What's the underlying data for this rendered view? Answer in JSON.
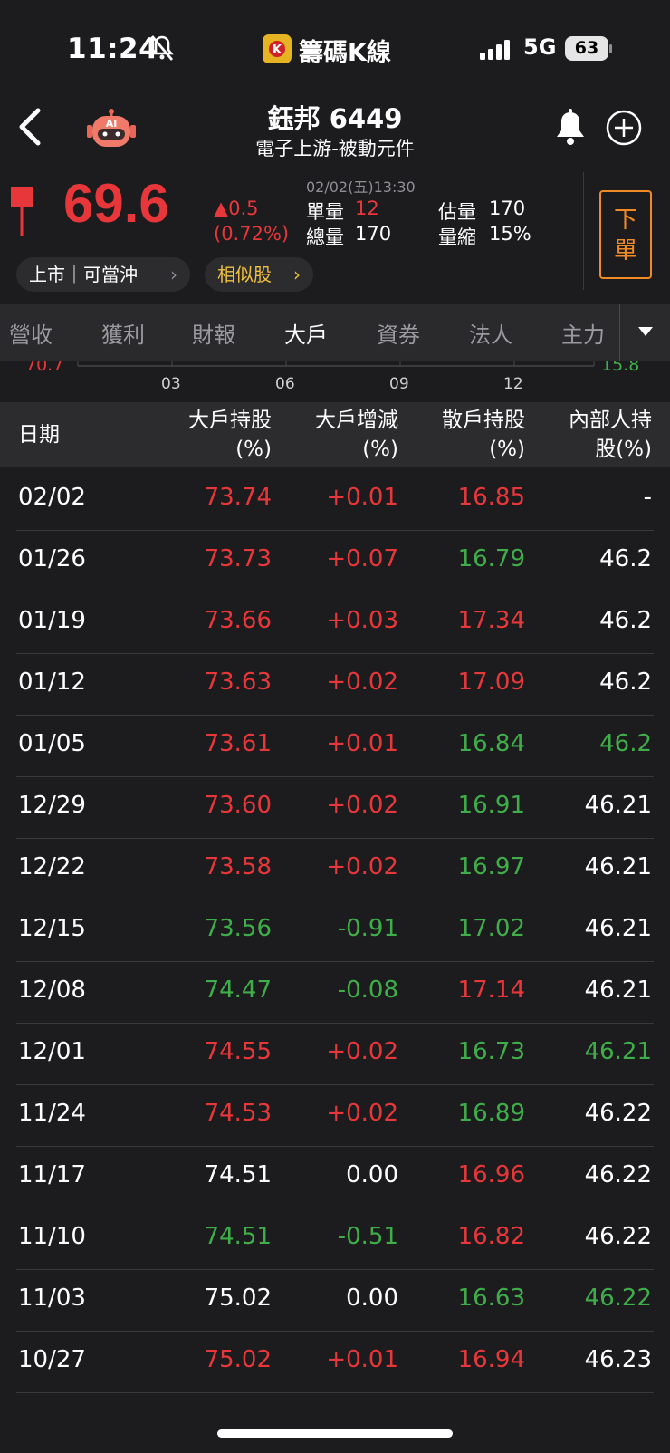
{
  "status_bar": {
    "time": "11:24",
    "app_name": "籌碼K線",
    "network": "5G",
    "battery": "63"
  },
  "header": {
    "stock_name": "鈺邦 6449",
    "industry": "電子上游-被動元件"
  },
  "quote": {
    "price": "69.6",
    "change": "▲0.5",
    "change_pct": "(0.72%)",
    "timestamp": "02/02(五)13:30",
    "unit_vol_label": "單量",
    "unit_vol": "12",
    "total_vol_label": "總量",
    "total_vol": "170",
    "est_vol_label": "估量",
    "est_vol": "170",
    "vol_shrink_label": "量縮",
    "vol_shrink": "15%",
    "order_button": "下\n單",
    "chip_market": "上市｜可當沖",
    "chip_similar": "相似股",
    "colors": {
      "up": "#e8373b",
      "down": "#3fae4a",
      "accent": "#f08a24"
    }
  },
  "tabs": [
    "營收",
    "獲利",
    "財報",
    "大戶",
    "資券",
    "法人",
    "主力"
  ],
  "active_tab": "大戶",
  "chart_strip": {
    "left_value": "70.7",
    "right_value": "15.8",
    "x_ticks": [
      "03",
      "06",
      "09",
      "12"
    ]
  },
  "table": {
    "headers": {
      "date": "日期",
      "big_holder_1": "大戶持股",
      "big_holder_2": "(%)",
      "big_change_1": "大戶增減",
      "big_change_2": "(%)",
      "retail_1": "散戶持股",
      "retail_2": "(%)",
      "insider_1": "內部人持",
      "insider_2": "股(%)"
    },
    "rows": [
      {
        "date": "02/02",
        "big": "73.74",
        "chg": "+0.01",
        "retail": "16.85",
        "insider": "-"
      },
      {
        "date": "01/26",
        "big": "73.73",
        "chg": "+0.07",
        "retail": "16.79",
        "insider": "46.2"
      },
      {
        "date": "01/19",
        "big": "73.66",
        "chg": "+0.03",
        "retail": "17.34",
        "insider": "46.2"
      },
      {
        "date": "01/12",
        "big": "73.63",
        "chg": "+0.02",
        "retail": "17.09",
        "insider": "46.2"
      },
      {
        "date": "01/05",
        "big": "73.61",
        "chg": "+0.01",
        "retail": "16.84",
        "insider": "46.2"
      },
      {
        "date": "12/29",
        "big": "73.60",
        "chg": "+0.02",
        "retail": "16.91",
        "insider": "46.21"
      },
      {
        "date": "12/22",
        "big": "73.58",
        "chg": "+0.02",
        "retail": "16.97",
        "insider": "46.21"
      },
      {
        "date": "12/15",
        "big": "73.56",
        "chg": "-0.91",
        "retail": "17.02",
        "insider": "46.21"
      },
      {
        "date": "12/08",
        "big": "74.47",
        "chg": "-0.08",
        "retail": "17.14",
        "insider": "46.21"
      },
      {
        "date": "12/01",
        "big": "74.55",
        "chg": "+0.02",
        "retail": "16.73",
        "insider": "46.21"
      },
      {
        "date": "11/24",
        "big": "74.53",
        "chg": "+0.02",
        "retail": "16.89",
        "insider": "46.22"
      },
      {
        "date": "11/17",
        "big": "74.51",
        "chg": "0.00",
        "retail": "16.96",
        "insider": "46.22"
      },
      {
        "date": "11/10",
        "big": "74.51",
        "chg": "-0.51",
        "retail": "16.82",
        "insider": "46.22"
      },
      {
        "date": "11/03",
        "big": "75.02",
        "chg": "0.00",
        "retail": "16.63",
        "insider": "46.22"
      },
      {
        "date": "10/27",
        "big": "75.02",
        "chg": "+0.01",
        "retail": "16.94",
        "insider": "46.23"
      }
    ],
    "row_colors": [
      [
        "red",
        "red",
        "red",
        "white"
      ],
      [
        "red",
        "red",
        "green",
        "white"
      ],
      [
        "red",
        "red",
        "red",
        "white"
      ],
      [
        "red",
        "red",
        "red",
        "white"
      ],
      [
        "red",
        "red",
        "green",
        "green"
      ],
      [
        "red",
        "red",
        "green",
        "white"
      ],
      [
        "red",
        "red",
        "green",
        "white"
      ],
      [
        "green",
        "green",
        "green",
        "white"
      ],
      [
        "green",
        "green",
        "red",
        "white"
      ],
      [
        "red",
        "red",
        "green",
        "green"
      ],
      [
        "red",
        "red",
        "green",
        "white"
      ],
      [
        "white",
        "white",
        "red",
        "white"
      ],
      [
        "green",
        "green",
        "red",
        "white"
      ],
      [
        "white",
        "white",
        "green",
        "green"
      ],
      [
        "red",
        "red",
        "red",
        "white"
      ]
    ]
  }
}
